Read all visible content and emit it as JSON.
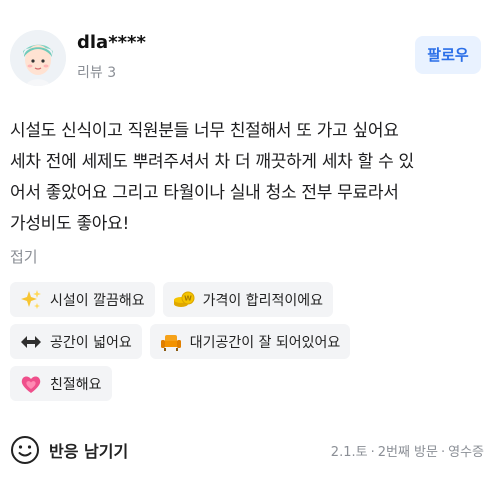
{
  "user": {
    "name": "dla****",
    "review_count": "리뷰 3",
    "follow_label": "팔로우"
  },
  "review": {
    "lines": [
      "시설도 신식이고 직원분들 너무 친절해서 또 가고 싶어요",
      "세차 전에 세제도 뿌려주셔서 차 더 깨끗하게 세차 할 수 있",
      "어서 좋았어요 그리고 타월이나 실내 청소 전부 무료라서",
      "가성비도 좋아요!"
    ],
    "fold_label": "접기"
  },
  "tags": [
    {
      "icon": "sparkles-icon",
      "label": "시설이 깔끔해요"
    },
    {
      "icon": "coins-icon",
      "label": "가격이 합리적이에요"
    },
    {
      "icon": "left-right-arrow-icon",
      "label": "공간이 넓어요"
    },
    {
      "icon": "armchair-icon",
      "label": "대기공간이 잘 되어있어요"
    },
    {
      "icon": "heart-icon",
      "label": "친절해요"
    }
  ],
  "footer": {
    "react_label": "반응 남기기",
    "date": "2.1.토",
    "visit": "2번째 방문",
    "receipt": "영수증"
  }
}
